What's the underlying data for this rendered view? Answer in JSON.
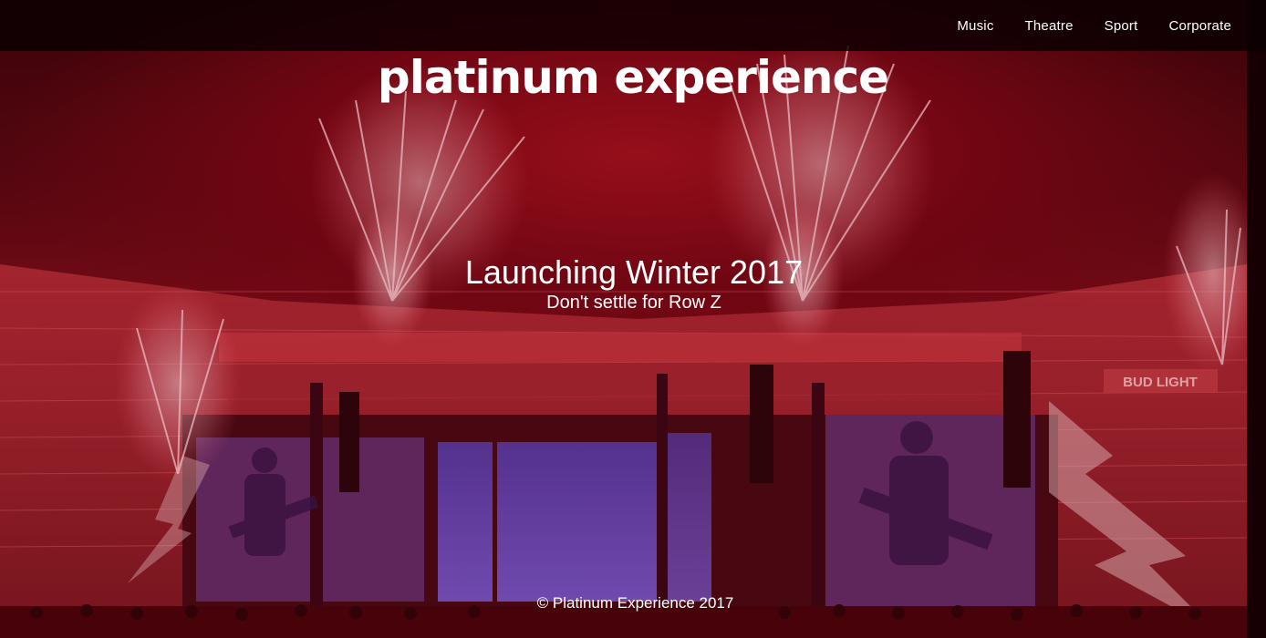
{
  "nav": {
    "items": [
      {
        "label": "Music"
      },
      {
        "label": "Theatre"
      },
      {
        "label": "Sport"
      },
      {
        "label": "Corporate"
      }
    ]
  },
  "brand": {
    "title": "platinum experience"
  },
  "hero": {
    "headline": "Launching Winter 2017",
    "subheadline": "Don't settle for Row Z",
    "sign_text": "BUD LIGHT"
  },
  "footer": {
    "copyright": "© Platinum Experience 2017"
  },
  "colors": {
    "overlay": "#8b0a16",
    "text": "#ffffff",
    "nav_bg": "#0a0002"
  }
}
